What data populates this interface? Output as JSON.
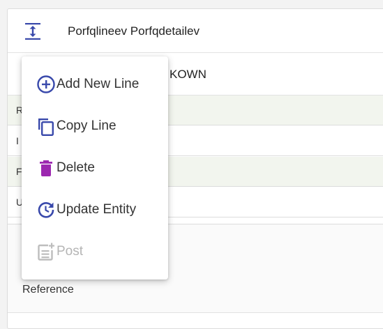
{
  "header": {
    "title": "Porfqlineev Porfqdetailev",
    "expand_icon": "vertical-resize-icon"
  },
  "row2": {
    "value": "KOWN"
  },
  "grid": {
    "rows": [
      {
        "label": "R"
      },
      {
        "label": "I"
      },
      {
        "label": "F"
      },
      {
        "label": "U"
      }
    ]
  },
  "reference": {
    "label": "Reference"
  },
  "context_menu": {
    "items": [
      {
        "label": "Add New Line",
        "icon": "add-circle-icon",
        "color": "#3949ab",
        "enabled": true
      },
      {
        "label": "Copy Line",
        "icon": "copy-icon",
        "color": "#3949ab",
        "enabled": true
      },
      {
        "label": "Delete",
        "icon": "trash-icon",
        "color": "#9c27b0",
        "enabled": true
      },
      {
        "label": "Update Entity",
        "icon": "refresh-clock-icon",
        "color": "#3949ab",
        "enabled": true
      },
      {
        "label": "Post",
        "icon": "post-add-icon",
        "color": "#bdbdbd",
        "enabled": false
      }
    ]
  },
  "colors": {
    "accent": "#3949ab",
    "delete": "#9c27b0",
    "disabled": "#bdbdbd",
    "row_tint": "#f2f5ee"
  }
}
